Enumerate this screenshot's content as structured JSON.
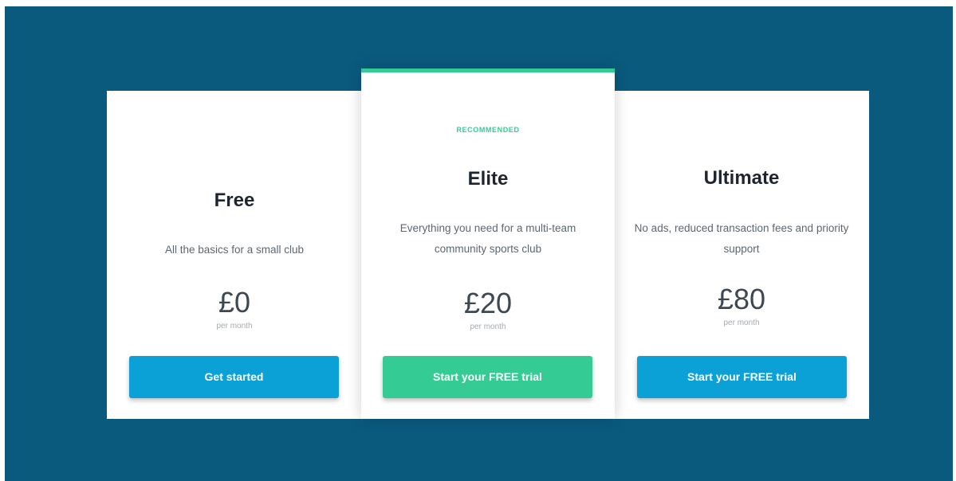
{
  "plans": [
    {
      "name": "Free",
      "badge": "",
      "description": "All the basics for a small club",
      "price": "£0",
      "period": "per month",
      "cta": "Get started"
    },
    {
      "name": "Elite",
      "badge": "RECOMMENDED",
      "description": "Everything you need for a multi-team community sports club",
      "price": "£20",
      "period": "per month",
      "cta": "Start your FREE trial"
    },
    {
      "name": "Ultimate",
      "badge": "",
      "description": "No ads, reduced transaction fees and priority support",
      "price": "£80",
      "period": "per month",
      "cta": "Start your FREE trial"
    }
  ],
  "colors": {
    "background": "#0a5a7e",
    "primary_button": "#0ca1d6",
    "accent_green": "#34cc94",
    "heading": "#1d2630"
  }
}
